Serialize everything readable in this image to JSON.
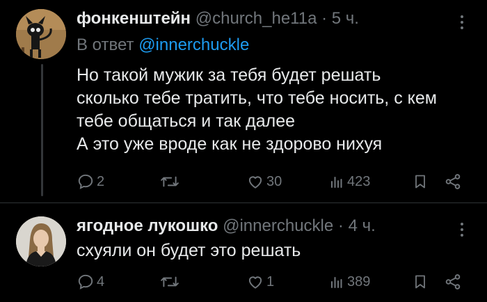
{
  "tweets": [
    {
      "display_name": "фонкенштейн",
      "handle": "@church_he11a",
      "dot": "·",
      "time": "5 ч.",
      "reply_prefix": "В ответ",
      "reply_handle": "@innerchuckle",
      "lines": [
        "Но такой мужик за тебя будет решать",
        "сколько тебе тратить, что тебе носить, с кем",
        "тебе общаться и так далее",
        "А это уже вроде как не здорово нихуя"
      ],
      "replies": "2",
      "retweets": "",
      "likes": "30",
      "views": "423"
    },
    {
      "display_name": "ягодное лукошко",
      "handle": "@innerchuckle",
      "dot": "·",
      "time": "4 ч.",
      "lines": [
        "схуяли он будет это решать"
      ],
      "replies": "4",
      "retweets": "",
      "likes": "1",
      "views": "389"
    }
  ],
  "icons": {
    "reply": "comment-bubble-icon",
    "retweet": "retweet-icon",
    "like": "heart-icon",
    "views": "bar-chart-icon",
    "bookmark": "bookmark-icon",
    "share": "share-icon",
    "more": "more-dots-icon"
  },
  "colors": {
    "background": "#000000",
    "text": "#e7e9ea",
    "muted": "#71767b",
    "link": "#1d9bf0",
    "divider": "#2f3336"
  }
}
